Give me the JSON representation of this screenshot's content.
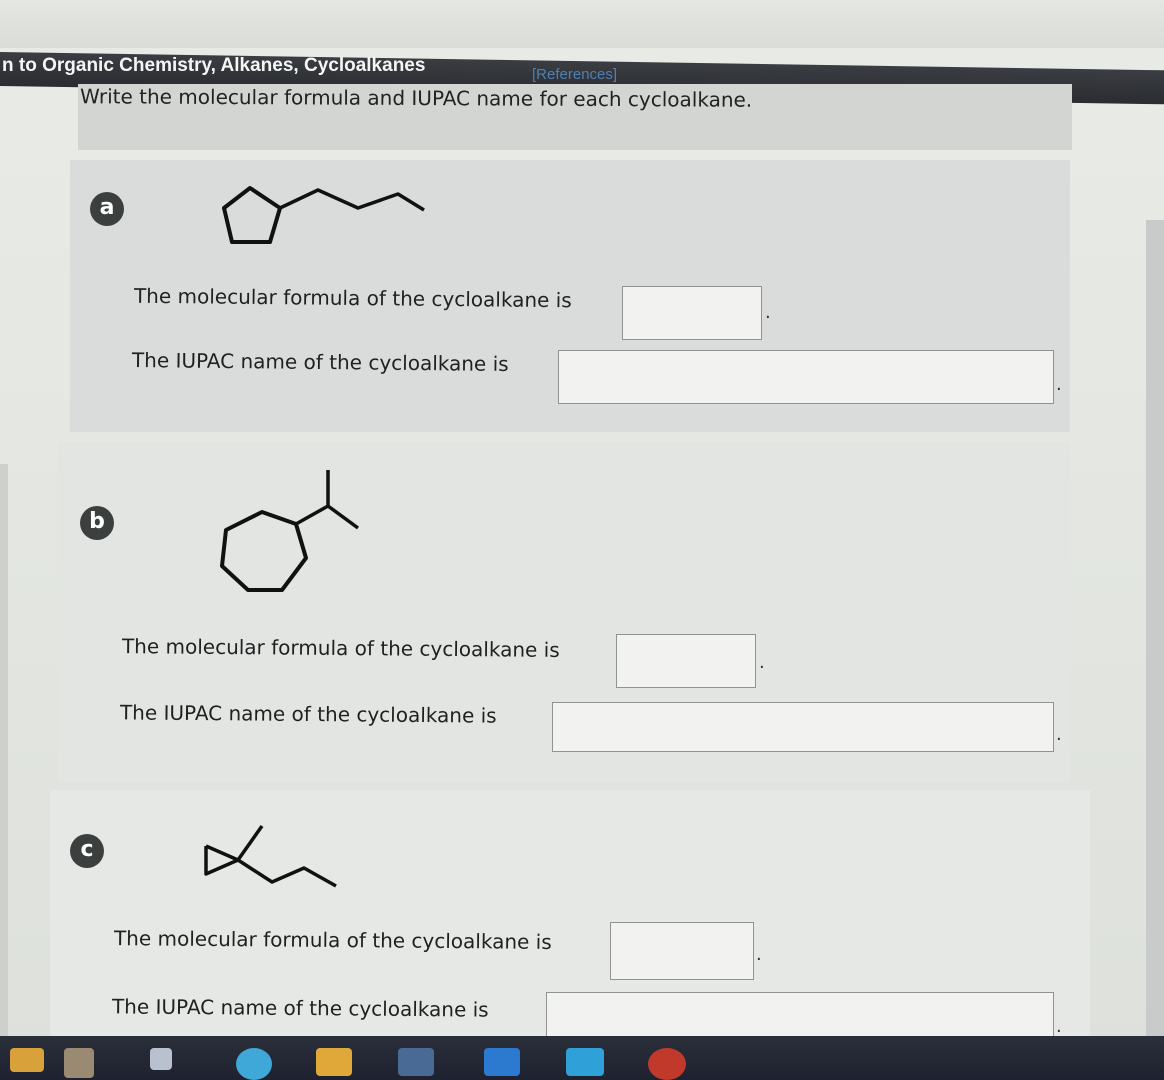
{
  "header": {
    "title": "n to Organic Chemistry, Alkanes, Cycloalkanes",
    "references_link": "[References]"
  },
  "instruction": "Write the molecular formula and IUPAC name for each cycloalkane.",
  "questions": [
    {
      "badge": "a",
      "formula_prompt": "The molecular formula of the cycloalkane is",
      "name_prompt": "The IUPAC name of the cycloalkane is",
      "formula_value": "",
      "name_value": ""
    },
    {
      "badge": "b",
      "formula_prompt": "The molecular formula of the cycloalkane is",
      "name_prompt": "The IUPAC name of the cycloalkane is",
      "formula_value": "",
      "name_value": ""
    },
    {
      "badge": "c",
      "formula_prompt": "The molecular formula of the cycloalkane is",
      "name_prompt": "The IUPAC name of the cycloalkane is",
      "formula_value": "",
      "name_value": ""
    }
  ],
  "punctuation": ".",
  "colors": {
    "header_bg": "#2a2c30",
    "references": "#4f7fb5",
    "badge_bg": "#3b3f3e",
    "taskbar": "#1e2230"
  }
}
